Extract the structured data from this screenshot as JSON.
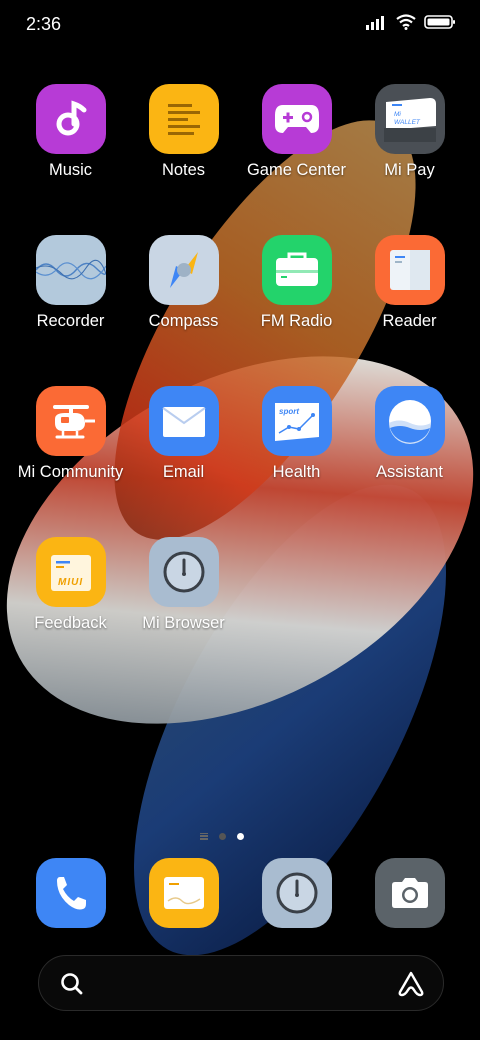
{
  "status_bar": {
    "time": "2:36",
    "icons": [
      "signal-icon",
      "wifi-icon",
      "battery-icon"
    ]
  },
  "apps": [
    {
      "label": "Music",
      "icon": "music-icon",
      "color": "#b73bd6"
    },
    {
      "label": "Notes",
      "icon": "notes-icon",
      "color": "#fbb513"
    },
    {
      "label": "Game Center",
      "icon": "game-controller-icon",
      "color": "#b73bd6"
    },
    {
      "label": "Mi Pay",
      "icon": "wallet-icon",
      "color": "#4a4f55",
      "icon_text": "Mi WALLET"
    },
    {
      "label": "Recorder",
      "icon": "recorder-icon",
      "color": "#b3c9dc"
    },
    {
      "label": "Compass",
      "icon": "compass-icon",
      "color": "#c9d6e4"
    },
    {
      "label": "FM Radio",
      "icon": "radio-icon",
      "color": "#23d36b"
    },
    {
      "label": "Reader",
      "icon": "reader-icon",
      "color": "#fb6a35"
    },
    {
      "label": "Mi Community",
      "icon": "helicopter-icon",
      "color": "#fb6a35"
    },
    {
      "label": "Email",
      "icon": "mail-icon",
      "color": "#3e86f5"
    },
    {
      "label": "Health",
      "icon": "health-icon",
      "color": "#3e86f5",
      "icon_text": "sport"
    },
    {
      "label": "Assistant",
      "icon": "assistant-app-icon",
      "color": "#3e86f5"
    },
    {
      "label": "Feedback",
      "icon": "feedback-icon",
      "color": "#fbb513",
      "icon_text": "MIUI"
    },
    {
      "label": "Mi Browser",
      "icon": "browser-icon",
      "color": "#a9bcd0"
    }
  ],
  "page_indicator": {
    "pages": 2,
    "active_page": 2
  },
  "dock": [
    {
      "name": "phone",
      "icon": "phone-icon",
      "color": "#3e86f5"
    },
    {
      "name": "messages",
      "icon": "messages-icon",
      "color": "#fbb513"
    },
    {
      "name": "browser",
      "icon": "browser-icon",
      "color": "#a9bcd0"
    },
    {
      "name": "camera",
      "icon": "camera-icon",
      "color": "#5b6369"
    }
  ],
  "search_bar": {
    "left_icon": "search-icon",
    "right_icon": "assistant-icon"
  }
}
